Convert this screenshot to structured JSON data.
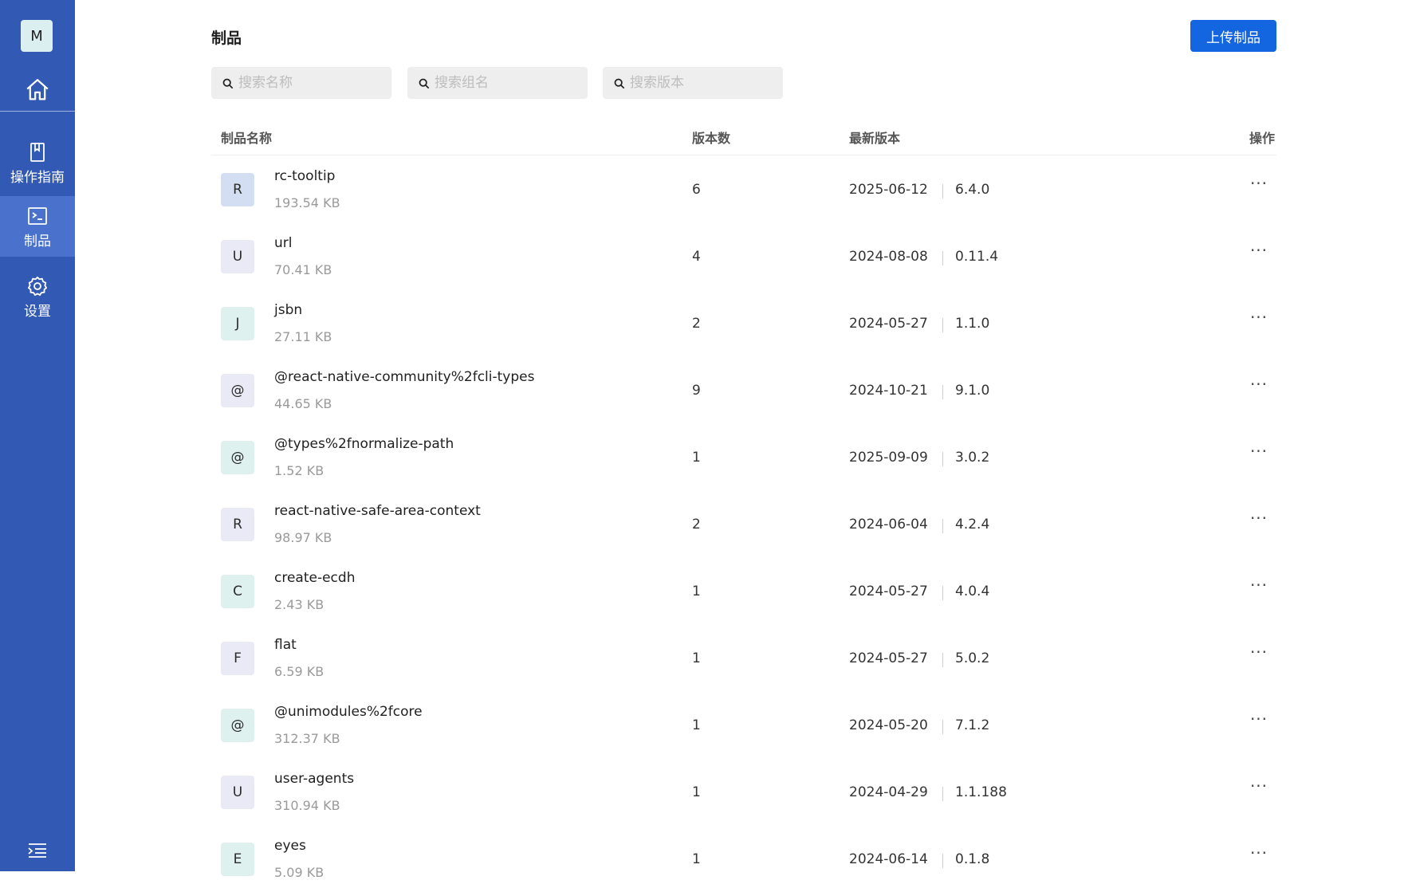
{
  "app": {
    "avatar_letter": "M"
  },
  "sidebar": {
    "items": [
      {
        "label": "操作指南",
        "icon": "bookmark-icon"
      },
      {
        "label": "制品",
        "icon": "terminal-icon"
      },
      {
        "label": "设置",
        "icon": "gear-icon"
      }
    ],
    "active": "制品"
  },
  "header": {
    "title": "制品",
    "upload_label": "上传制品"
  },
  "search": {
    "name_placeholder": "搜索名称",
    "group_placeholder": "搜索组名",
    "version_placeholder": "搜索版本"
  },
  "table": {
    "columns": [
      "制品名称",
      "版本数",
      "最新版本",
      "操作"
    ],
    "rows": [
      {
        "letter": "R",
        "name": "rc-tooltip",
        "size": "193.54 KB",
        "count": "6",
        "date": "2025-06-12",
        "version": "6.4.0",
        "color": "#d3def3"
      },
      {
        "letter": "U",
        "name": "url",
        "size": "70.41 KB",
        "count": "4",
        "date": "2024-08-08",
        "version": "0.11.4",
        "color": "#e9eaf5"
      },
      {
        "letter": "J",
        "name": "jsbn",
        "size": "27.11 KB",
        "count": "2",
        "date": "2024-05-27",
        "version": "1.1.0",
        "color": "#dff1ee"
      },
      {
        "letter": "@",
        "name": "@react-native-community%2fcli-types",
        "size": "44.65 KB",
        "count": "9",
        "date": "2024-10-21",
        "version": "9.1.0",
        "color": "#e9eaf5"
      },
      {
        "letter": "@",
        "name": "@types%2fnormalize-path",
        "size": "1.52 KB",
        "count": "1",
        "date": "2025-09-09",
        "version": "3.0.2",
        "color": "#dff1ee"
      },
      {
        "letter": "R",
        "name": "react-native-safe-area-context",
        "size": "98.97 KB",
        "count": "2",
        "date": "2024-06-04",
        "version": "4.2.4",
        "color": "#e9eaf5"
      },
      {
        "letter": "C",
        "name": "create-ecdh",
        "size": "2.43 KB",
        "count": "1",
        "date": "2024-05-27",
        "version": "4.0.4",
        "color": "#dff1ee"
      },
      {
        "letter": "F",
        "name": "flat",
        "size": "6.59 KB",
        "count": "1",
        "date": "2024-05-27",
        "version": "5.0.2",
        "color": "#e9eaf5"
      },
      {
        "letter": "@",
        "name": "@unimodules%2fcore",
        "size": "312.37 KB",
        "count": "1",
        "date": "2024-05-20",
        "version": "7.1.2",
        "color": "#dff1ee"
      },
      {
        "letter": "U",
        "name": "user-agents",
        "size": "310.94 KB",
        "count": "1",
        "date": "2024-04-29",
        "version": "1.1.188",
        "color": "#e9eaf5"
      },
      {
        "letter": "E",
        "name": "eyes",
        "size": "5.09 KB",
        "count": "1",
        "date": "2024-06-14",
        "version": "0.1.8",
        "color": "#dff1ee"
      }
    ]
  },
  "colors": {
    "sidebar_bg": "#3259b3",
    "sidebar_active": "#4a72cc",
    "primary_button": "#1366e0"
  }
}
